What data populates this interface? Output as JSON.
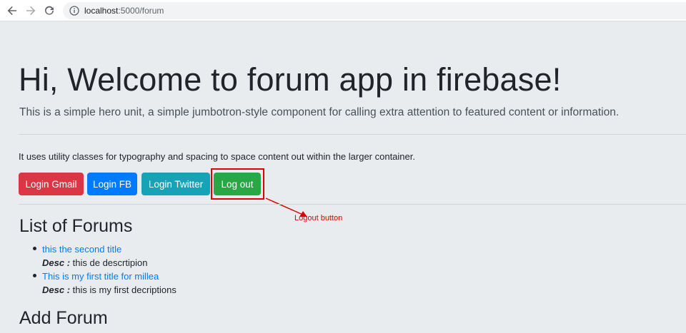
{
  "browser": {
    "url_host": "localhost",
    "url_rest": ":5000/forum"
  },
  "hero": {
    "title": "Hi, Welcome to forum app in firebase!",
    "lead": "This is a simple hero unit, a simple jumbotron-style component for calling extra attention to featured content or information.",
    "info": "It uses utility classes for typography and spacing to space content out within the larger container."
  },
  "buttons": {
    "login_gmail": "Login Gmail",
    "login_fb": "Login FB",
    "login_twitter": "Login Twitter",
    "logout": "Log out"
  },
  "annotation": {
    "label": "Logout button",
    "color": "#e00000"
  },
  "forums": {
    "heading": "List of Forums",
    "items": [
      {
        "title": "this the second title",
        "desc_label": "Desc :",
        "desc": "this de descrtipion"
      },
      {
        "title": "This is my first title for millea",
        "desc_label": "Desc :",
        "desc": "this is my first decriptions"
      }
    ]
  },
  "add_forum": {
    "heading": "Add Forum"
  },
  "colors": {
    "danger": "#dc3545",
    "primary": "#007bff",
    "info": "#17a2b8",
    "success": "#28a745",
    "background": "#e9ecef"
  },
  "icons": [
    "back-arrow-icon",
    "forward-arrow-icon",
    "reload-icon",
    "info-icon",
    "bullet-icon"
  ]
}
